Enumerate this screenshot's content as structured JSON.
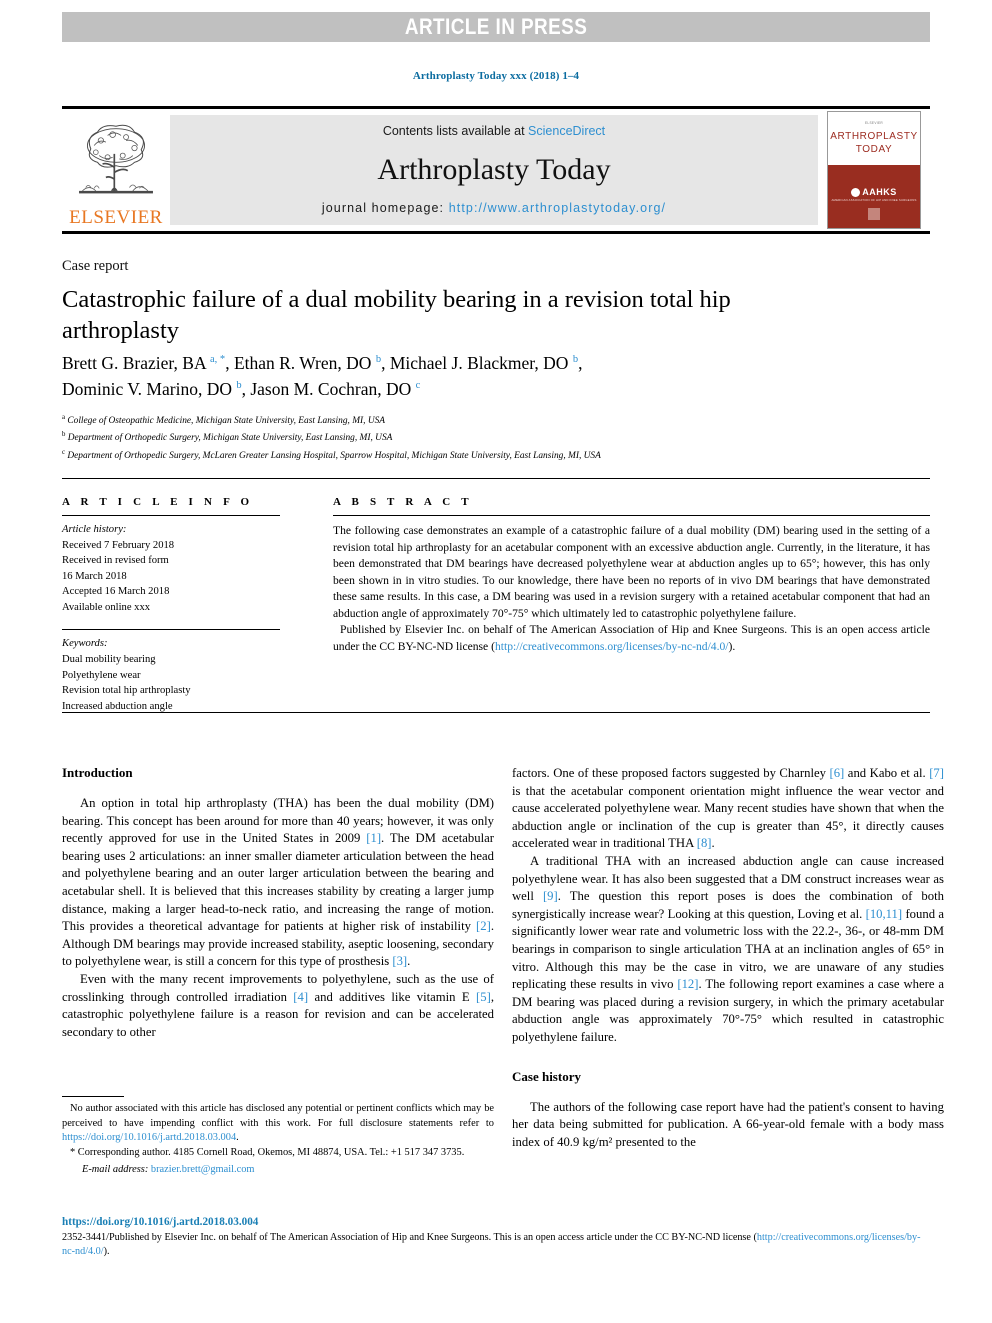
{
  "banner": {
    "text": "ARTICLE IN PRESS",
    "bg_color": "#c0c0c0",
    "text_color": "#ffffff"
  },
  "running_head": "Arthroplasty Today xxx (2018) 1–4",
  "masthead": {
    "publisher_wordmark": "ELSEVIER",
    "publisher_color": "#e87722",
    "contents_prefix": "Contents lists available at ",
    "contents_link": "ScienceDirect",
    "journal_title": "Arthroplasty Today",
    "homepage_prefix": "journal homepage: ",
    "homepage_link": "http://www.arthroplastytoday.org/",
    "link_color": "#2e8fd0",
    "cover": {
      "top_label": "ELSEVIER",
      "line1": "ARTHROPLASTY",
      "line2": "TODAY",
      "society": "AAHKS",
      "society_sub": "AMERICAN ASSOCIATION OF HIP AND KNEE SURGEONS",
      "accent_color": "#992d20"
    }
  },
  "article": {
    "type_label": "Case report",
    "title": "Catastrophic failure of a dual mobility bearing in a revision total hip arthroplasty",
    "authors_line1_a": "Brett G. Brazier, BA ",
    "authors_sup_a": "a, *",
    "authors_line1_b": ", Ethan R. Wren, DO ",
    "authors_sup_b": "b",
    "authors_line1_c": ", Michael J. Blackmer, DO ",
    "authors_sup_c": "b",
    "authors_line1_d": ",",
    "authors_line2_a": "Dominic V. Marino, DO ",
    "authors_sup_d": "b",
    "authors_line2_b": ", Jason M. Cochran, DO ",
    "authors_sup_e": "c",
    "affiliations": [
      {
        "mark": "a",
        "text": "College of Osteopathic Medicine, Michigan State University, East Lansing, MI, USA"
      },
      {
        "mark": "b",
        "text": "Department of Orthopedic Surgery, Michigan State University, East Lansing, MI, USA"
      },
      {
        "mark": "c",
        "text": "Department of Orthopedic Surgery, McLaren Greater Lansing Hospital, Sparrow Hospital, Michigan State University, East Lansing, MI, USA"
      }
    ]
  },
  "article_info": {
    "heading": "A R T I C L E   I N F O",
    "history_label": "Article history:",
    "history": [
      "Received 7 February 2018",
      "Received in revised form",
      "16 March 2018",
      "Accepted 16 March 2018",
      "Available online xxx"
    ],
    "keywords_label": "Keywords:",
    "keywords": [
      "Dual mobility bearing",
      "Polyethylene wear",
      "Revision total hip arthroplasty",
      "Increased abduction angle"
    ]
  },
  "abstract": {
    "heading": "A B S T R A C T",
    "body": "The following case demonstrates an example of a catastrophic failure of a dual mobility (DM) bearing used in the setting of a revision total hip arthroplasty for an acetabular component with an excessive abduction angle. Currently, in the literature, it has been demonstrated that DM bearings have decreased polyethylene wear at abduction angles up to 65°; however, this has only been shown in in vitro studies. To our knowledge, there have been no reports of in vivo DM bearings that have demonstrated these same results. In this case, a DM bearing was used in a revision surgery with a retained acetabular component that had an abduction angle of approximately 70°-75° which ultimately led to catastrophic polyethylene failure.",
    "published_prefix": "Published by Elsevier Inc. on behalf of The American Association of Hip and Knee Surgeons. This is an open access article under the CC BY-NC-ND license (",
    "published_link": "http://creativecommons.org/licenses/by-nc-nd/4.0/",
    "published_suffix": ")."
  },
  "body_left": {
    "heading": "Introduction",
    "p1_a": "An option in total hip arthroplasty (THA) has been the dual mobility (DM) bearing. This concept has been around for more than 40 years; however, it was only recently approved for use in the United States in 2009 ",
    "p1_ref1": "[1]",
    "p1_b": ". The DM acetabular bearing uses 2 articulations: an inner smaller diameter articulation between the head and polyethylene bearing and an outer larger articulation between the bearing and acetabular shell. It is believed that this increases stability by creating a larger jump distance, making a larger head-to-neck ratio, and increasing the range of motion. This provides a theoretical advantage for patients at higher risk of instability ",
    "p1_ref2": "[2]",
    "p1_c": ". Although DM bearings may provide increased stability, aseptic loosening, secondary to polyethylene wear, is still a concern for this type of prosthesis ",
    "p1_ref3": "[3]",
    "p1_d": ".",
    "p2_a": "Even with the many recent improvements to polyethylene, such as the use of crosslinking through controlled irradiation ",
    "p2_ref4": "[4]",
    "p2_b": " and additives like vitamin E ",
    "p2_ref5": "[5]",
    "p2_c": ", catastrophic polyethylene failure is a reason for revision and can be accelerated secondary to other"
  },
  "body_right": {
    "p1_a": "factors. One of these proposed factors suggested by Charnley ",
    "p1_ref6": "[6]",
    "p1_b": " and Kabo et al. ",
    "p1_ref7": "[7]",
    "p1_c": " is that the acetabular component orientation might influence the wear vector and cause accelerated polyethylene wear. Many recent studies have shown that when the abduction angle or inclination of the cup is greater than 45°, it directly causes accelerated wear in traditional THA ",
    "p1_ref8": "[8]",
    "p1_d": ".",
    "p2_a": "A traditional THA with an increased abduction angle can cause increased polyethylene wear. It has also been suggested that a DM construct increases wear as well ",
    "p2_ref9": "[9]",
    "p2_b": ". The question this report poses is does the combination of both synergistically increase wear? Looking at this question, Loving et al. ",
    "p2_ref10": "[10,11]",
    "p2_c": " found a significantly lower wear rate and volumetric loss with the 22.2-, 36-, or 48-mm DM bearings in comparison to single articulation THA at an inclination angles of 65° in vitro. Although this may be the case in vitro, we are unaware of any studies replicating these results in vivo ",
    "p2_ref12": "[12]",
    "p2_d": ". The following report examines a case where a DM bearing was placed during a revision surgery, in which the primary acetabular abduction angle was approximately 70°-75° which resulted in catastrophic polyethylene failure.",
    "heading2": "Case history",
    "p3": "The authors of the following case report have had the patient's consent to having her data being submitted for publication. A 66-year-old female with a body mass index of 40.9 kg/m² presented to the"
  },
  "footnote": {
    "disclosure_a": "No author associated with this article has disclosed any potential or pertinent conflicts which may be perceived to have impending conflict with this work. For full disclosure statements refer to ",
    "disclosure_link": "https://doi.org/10.1016/j.artd.2018.03.004",
    "disclosure_b": ".",
    "corresponding_mark": "*",
    "corresponding": " Corresponding author. 4185 Cornell Road, Okemos, MI 48874, USA. Tel.: +1 517 347 3735.",
    "email_label": "E-mail address:",
    "email": "brazier.brett@gmail.com"
  },
  "publisher_footer": {
    "doi": "https://doi.org/10.1016/j.artd.2018.03.004",
    "issn_line_a": "2352-3441/Published by Elsevier Inc. on behalf of The American Association of Hip and Knee Surgeons. This is an open access article under the CC BY-NC-ND license (",
    "issn_link": "http://creativecommons.org/licenses/by-nc-nd/4.0/",
    "issn_line_b": ")."
  }
}
